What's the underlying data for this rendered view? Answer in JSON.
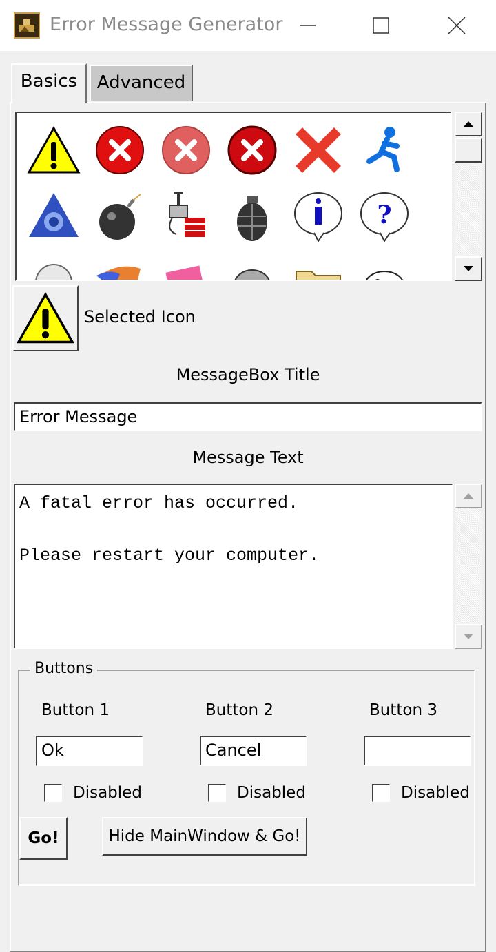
{
  "window": {
    "title": "Error Message Generator",
    "app_icon": "app-icon"
  },
  "tabs": [
    {
      "label": "Basics",
      "selected": true
    },
    {
      "label": "Advanced",
      "selected": false
    }
  ],
  "icons": [
    "warning-icon",
    "error-red-x-icon",
    "error-faded-x-icon",
    "error-dark-x-icon",
    "red-x-icon",
    "aim-runner-icon",
    "aol-pyramid-icon",
    "bomb-icon",
    "dynamite-plunger-icon",
    "grenade-icon",
    "info-bubble-icon",
    "question-bubble-icon",
    "sphere-icon",
    "wing-icon",
    "pink-box-icon",
    "dog-icon",
    "folder-icon",
    "cow-icon"
  ],
  "selected_icon": {
    "icon": "warning-icon",
    "label": "Selected Icon"
  },
  "messagebox_title": {
    "label": "MessageBox Title",
    "value": "Error Message"
  },
  "message_text": {
    "label": "Message Text",
    "value": "A fatal error has occurred.\n\nPlease restart your computer."
  },
  "buttons_group": {
    "label": "Buttons",
    "buttons": [
      {
        "label": "Button 1",
        "value": "Ok",
        "disabled_label": "Disabled",
        "disabled": false
      },
      {
        "label": "Button 2",
        "value": "Cancel",
        "disabled_label": "Disabled",
        "disabled": false
      },
      {
        "label": "Button 3",
        "value": "",
        "disabled_label": "Disabled",
        "disabled": false
      }
    ],
    "go_label": "Go!",
    "hide_go_label": "Hide MainWindow & Go!"
  }
}
